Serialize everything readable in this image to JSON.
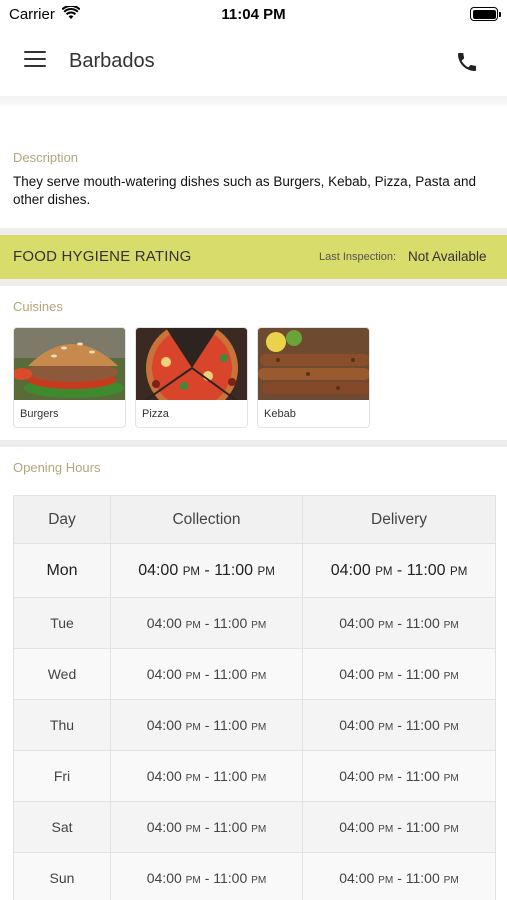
{
  "status_bar": {
    "carrier": "Carrier",
    "time": "11:04 PM",
    "icons": [
      "wifi-icon",
      "battery-icon"
    ]
  },
  "nav": {
    "title": "Barbados",
    "menu_icon": "hamburger-menu-icon",
    "call_icon": "phone-icon"
  },
  "description": {
    "label": "Description",
    "text": "They serve mouth-watering dishes such as Burgers, Kebab, Pizza, Pasta and other dishes."
  },
  "hygiene": {
    "title": "FOOD HYGIENE RATING",
    "inspection_label": "Last Inspection:",
    "inspection_value": "Not Available",
    "color": "#d8dc6a"
  },
  "cuisines": {
    "label": "Cuisines",
    "items": [
      {
        "name": "Burgers"
      },
      {
        "name": "Pizza"
      },
      {
        "name": "Kebab"
      }
    ]
  },
  "opening_hours": {
    "label": "Opening Hours",
    "headers": [
      "Day",
      "Collection",
      "Delivery"
    ],
    "rows": [
      {
        "day": "Mon",
        "collection": {
          "open": "04:00",
          "open_ampm": "PM",
          "close": "11:00",
          "close_ampm": "PM"
        },
        "delivery": {
          "open": "04:00",
          "open_ampm": "PM",
          "close": "11:00",
          "close_ampm": "PM"
        }
      },
      {
        "day": "Tue",
        "collection": {
          "open": "04:00",
          "open_ampm": "PM",
          "close": "11:00",
          "close_ampm": "PM"
        },
        "delivery": {
          "open": "04:00",
          "open_ampm": "PM",
          "close": "11:00",
          "close_ampm": "PM"
        }
      },
      {
        "day": "Wed",
        "collection": {
          "open": "04:00",
          "open_ampm": "PM",
          "close": "11:00",
          "close_ampm": "PM"
        },
        "delivery": {
          "open": "04:00",
          "open_ampm": "PM",
          "close": "11:00",
          "close_ampm": "PM"
        }
      },
      {
        "day": "Thu",
        "collection": {
          "open": "04:00",
          "open_ampm": "PM",
          "close": "11:00",
          "close_ampm": "PM"
        },
        "delivery": {
          "open": "04:00",
          "open_ampm": "PM",
          "close": "11:00",
          "close_ampm": "PM"
        }
      },
      {
        "day": "Fri",
        "collection": {
          "open": "04:00",
          "open_ampm": "PM",
          "close": "11:00",
          "close_ampm": "PM"
        },
        "delivery": {
          "open": "04:00",
          "open_ampm": "PM",
          "close": "11:00",
          "close_ampm": "PM"
        }
      },
      {
        "day": "Sat",
        "collection": {
          "open": "04:00",
          "open_ampm": "PM",
          "close": "11:00",
          "close_ampm": "PM"
        },
        "delivery": {
          "open": "04:00",
          "open_ampm": "PM",
          "close": "11:00",
          "close_ampm": "PM"
        }
      },
      {
        "day": "Sun",
        "collection": {
          "open": "04:00",
          "open_ampm": "PM",
          "close": "11:00",
          "close_ampm": "PM"
        },
        "delivery": {
          "open": "04:00",
          "open_ampm": "PM",
          "close": "11:00",
          "close_ampm": "PM"
        }
      }
    ],
    "separator": "-"
  },
  "colors": {
    "section_label": "#b5a57c",
    "hygiene_bar": "#d8dc6a",
    "divider": "#ededed"
  }
}
